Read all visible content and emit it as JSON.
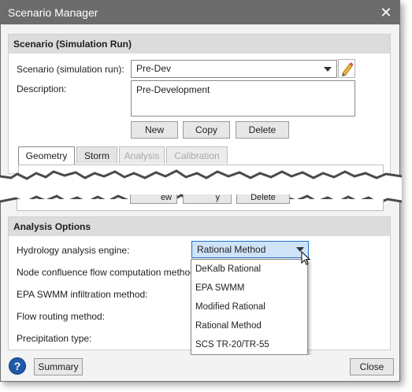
{
  "window": {
    "title": "Scenario Manager"
  },
  "scenario_section": {
    "header": "Scenario (Simulation Run)",
    "scenario_label": "Scenario (simulation run):",
    "scenario_value": "Pre-Dev",
    "description_label": "Description:",
    "description_value": "Pre-Development",
    "buttons": {
      "new": "New",
      "copy": "Copy",
      "delete": "Delete"
    }
  },
  "tabs": [
    {
      "label": "Geometry",
      "state": "active"
    },
    {
      "label": "Storm",
      "state": "normal"
    },
    {
      "label": "Analysis",
      "state": "disabled"
    },
    {
      "label": "Calibration",
      "state": "disabled"
    }
  ],
  "torn_fragment": {
    "new": "ew",
    "copy": "y",
    "delete": "Delete"
  },
  "analysis_section": {
    "header": "Analysis Options",
    "hydrology_label": "Hydrology analysis engine:",
    "hydrology_value": "Rational Method",
    "node_label": "Node confluence flow computation method:",
    "swmm_label": "EPA SWMM infiltration method:",
    "routing_label": "Flow routing method:",
    "precip_label": "Precipitation type:",
    "options": [
      "DeKalb Rational",
      "EPA SWMM",
      "Modified Rational",
      "Rational Method",
      "SCS TR-20/TR-55"
    ]
  },
  "footer": {
    "help": "?",
    "summary": "Summary",
    "close": "Close"
  },
  "colors": {
    "accent": "#1e6fc5",
    "selected_bg": "#cfe3f8",
    "titlebar": "#6c6c6c"
  }
}
